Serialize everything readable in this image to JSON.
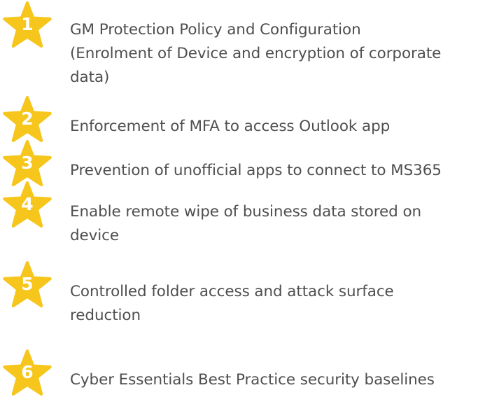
{
  "star_color": "#F6C61C",
  "number_color": "#FFFFFF",
  "text_color": "#4F4F4F",
  "items": [
    {
      "number": "1",
      "icon": "star-icon",
      "lines": [
        "GM Protection Policy and Configuration",
        "(Enrolment of Device and encryption of corporate",
        "data)"
      ]
    },
    {
      "number": "2",
      "icon": "star-icon",
      "lines": [
        "Enforcement of MFA to access Outlook app"
      ]
    },
    {
      "number": "3",
      "icon": "star-icon",
      "lines": [
        "Prevention of unofficial apps to connect to MS365"
      ]
    },
    {
      "number": "4",
      "icon": "star-icon",
      "lines": [
        "Enable remote wipe of business data stored on",
        "device"
      ]
    },
    {
      "number": "5",
      "icon": "star-icon",
      "lines": [
        "Controlled folder access and attack surface",
        "reduction"
      ]
    },
    {
      "number": "6",
      "icon": "star-icon",
      "lines": [
        "Cyber Essentials Best Practice security baselines"
      ]
    }
  ]
}
